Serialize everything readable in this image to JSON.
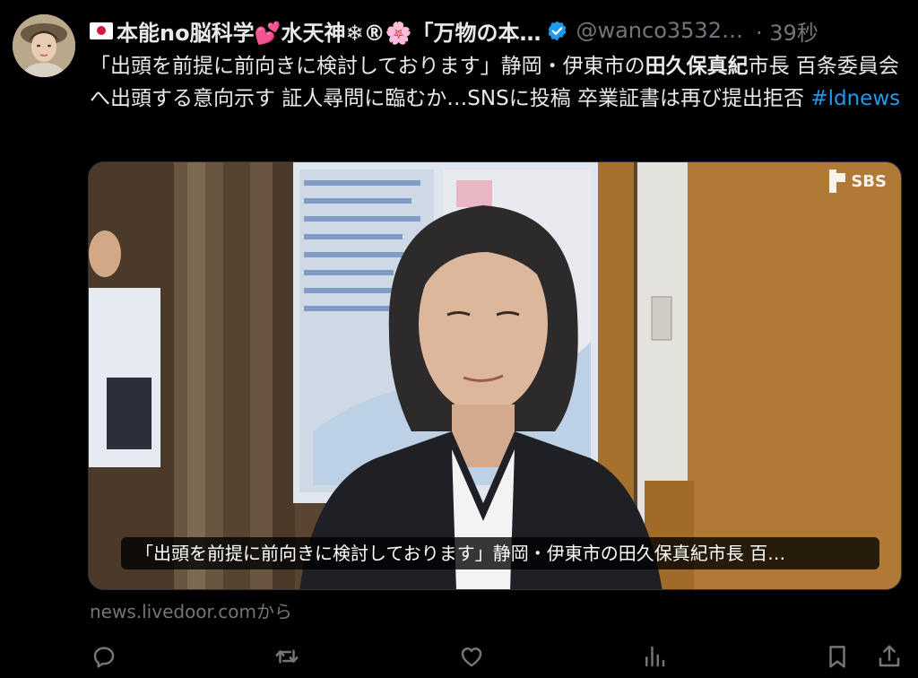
{
  "tweet": {
    "display_name": "本能no脳科学💕水天神❄®🌸「万物の本…",
    "handle": "@wanco3532…",
    "time": "· 39秒",
    "text_part1": "「出頭を前提に前向きに検討しております」静岡・伊東市の",
    "text_bold": "田久保真紀",
    "text_part2": "市長 百条委員会へ出頭する意向示す 証人尋問に臨むか…SNSに投稿 卒業証書は再び提出拒否 ",
    "hashtag": "#ldnews"
  },
  "media": {
    "watermark": "SBS",
    "caption": "「出頭を前提に前向きに検討しております」静岡・伊東市の田久保真紀市長 百…"
  },
  "card_source": "news.livedoor.comから",
  "actions": {
    "reply_icon": "reply-icon",
    "retweet_icon": "retweet-icon",
    "like_icon": "heart-icon",
    "views_icon": "views-icon",
    "bookmark_icon": "bookmark-icon",
    "share_icon": "share-icon"
  },
  "colors": {
    "background": "#000000",
    "text": "#e7e9ea",
    "muted": "#71767b",
    "link": "#1d9bf0",
    "verified": "#1d9bf0"
  }
}
